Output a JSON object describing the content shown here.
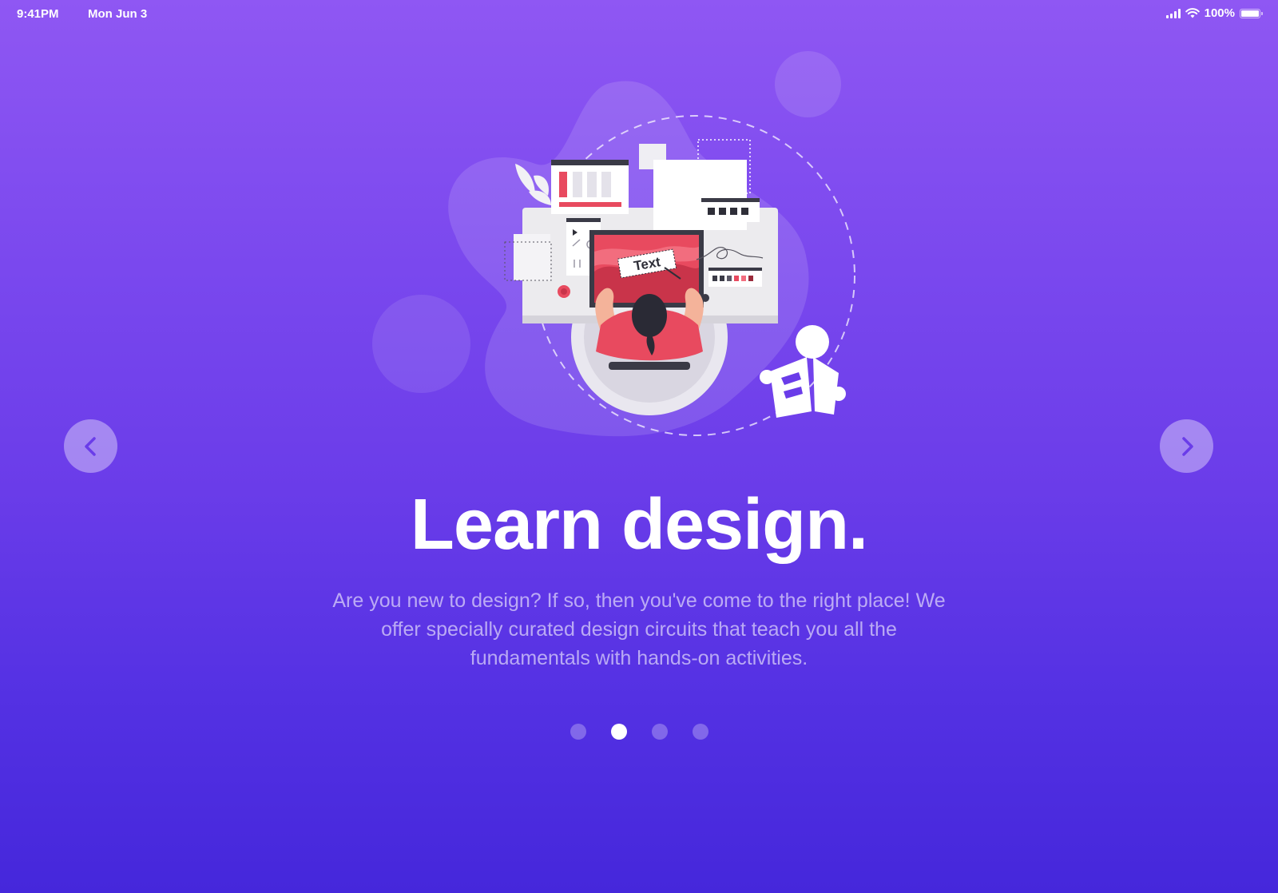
{
  "status_bar": {
    "time": "9:41PM",
    "date": "Mon Jun 3",
    "battery": "100%",
    "battery_level": 1.0,
    "icons": [
      "signal-icon",
      "wifi-icon",
      "battery-icon"
    ]
  },
  "illustration": {
    "screen_text": "Text",
    "icon": "reading-person-icon"
  },
  "onboarding": {
    "title": "Learn design.",
    "description": "Are you new to design? If so, then you've come to the right place! We offer specially curated design circuits that teach you all the fundamentals with hands-on activities."
  },
  "navigation": {
    "prev_icon": "chevron-left-icon",
    "next_icon": "chevron-right-icon"
  },
  "pager": {
    "total": 4,
    "active_index": 1
  },
  "colors": {
    "background_top": "#8f57f3",
    "background_bottom": "#4527db",
    "accent_red": "#e84a5f",
    "nav_button": "rgba(255,255,255,0.38)",
    "icon_purple": "#6a3ce9"
  }
}
